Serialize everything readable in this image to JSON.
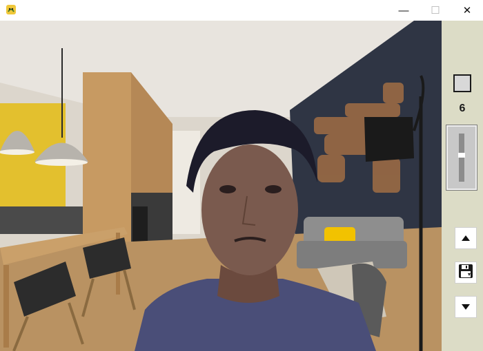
{
  "window": {
    "app_icon": "pygame-snake-icon",
    "controls": {
      "minimize": "—",
      "maximize": "☐",
      "close": "✕"
    }
  },
  "panel": {
    "toggle": {
      "checked": false
    },
    "count": "6",
    "slider": {
      "level": 0.45
    },
    "buttons": {
      "up": "triangle-up-icon",
      "save": "save-disk-icon",
      "down": "triangle-down-icon"
    }
  },
  "colors": {
    "panel_bg": "#dcdcc6",
    "wall_blue": "#2f3544",
    "accent_yellow": "#f2c200"
  }
}
